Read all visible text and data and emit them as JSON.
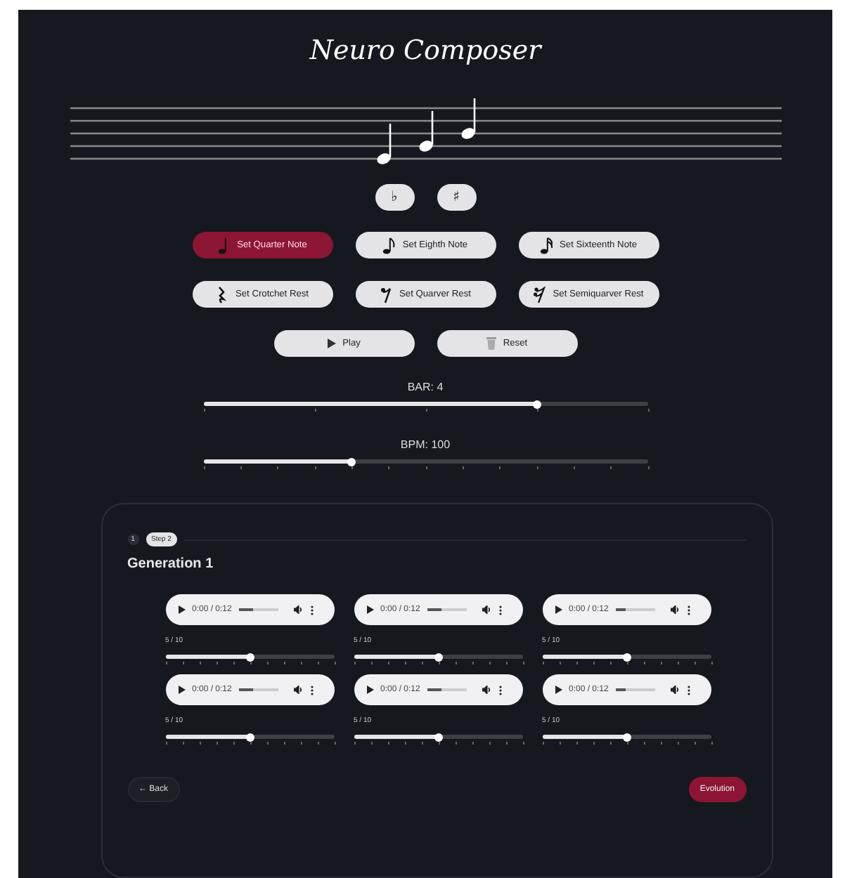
{
  "app": {
    "title": "Neuro Composer"
  },
  "accidentals": [
    {
      "symbol": "♭"
    },
    {
      "symbol": "♯"
    }
  ],
  "note_buttons": [
    {
      "kind": "quarter-note",
      "label": "Set Quarter Note",
      "selected": true
    },
    {
      "kind": "eighth-note",
      "label": "Set Eighth Note",
      "selected": false
    },
    {
      "kind": "sixteenth-note",
      "label": "Set Sixteenth Note",
      "selected": false
    },
    {
      "kind": "crotchet-rest",
      "label": "Set Crotchet Rest",
      "selected": false
    },
    {
      "kind": "quaver-rest",
      "label": "Set Quarver Rest",
      "selected": false
    },
    {
      "kind": "semiquaver-rest",
      "label": "Set Semiquarver Rest",
      "selected": false
    }
  ],
  "actions": [
    {
      "kind": "play",
      "label": "Play"
    },
    {
      "kind": "reset",
      "label": "Reset"
    }
  ],
  "sliders": [
    {
      "label": "BAR: 4",
      "level": 0.75,
      "kind": "coarse"
    },
    {
      "label": "BPM: 100",
      "level": 0.333,
      "kind": "fine"
    }
  ],
  "stepper": {
    "step_number": "1",
    "step_label": "Step 2"
  },
  "generation": {
    "title": "Generation 1",
    "samples": [
      {
        "player": {
          "time": "0:00 / 0:12",
          "level": 0.35
        },
        "rating": {
          "text": "5 / 10",
          "level": 0.5
        }
      },
      {
        "player": {
          "time": "0:00 / 0:12",
          "level": 0.35
        },
        "rating": {
          "text": "5 / 10",
          "level": 0.5
        }
      },
      {
        "player": {
          "time": "0:00 / 0:12",
          "level": 0.25
        },
        "rating": {
          "text": "5 / 10",
          "level": 0.5
        }
      },
      {
        "player": {
          "time": "0:00 / 0:12",
          "level": 0.35
        },
        "rating": {
          "text": "5 / 10",
          "level": 0.5
        }
      },
      {
        "player": {
          "time": "0:00 / 0:12",
          "level": 0.35
        },
        "rating": {
          "text": "5 / 10",
          "level": 0.5
        }
      },
      {
        "player": {
          "time": "0:00 / 0:12",
          "level": 0.25
        },
        "rating": {
          "text": "5 / 10",
          "level": 0.5
        }
      }
    ]
  },
  "footer": {
    "back": "← Back",
    "next": "Evolution"
  }
}
